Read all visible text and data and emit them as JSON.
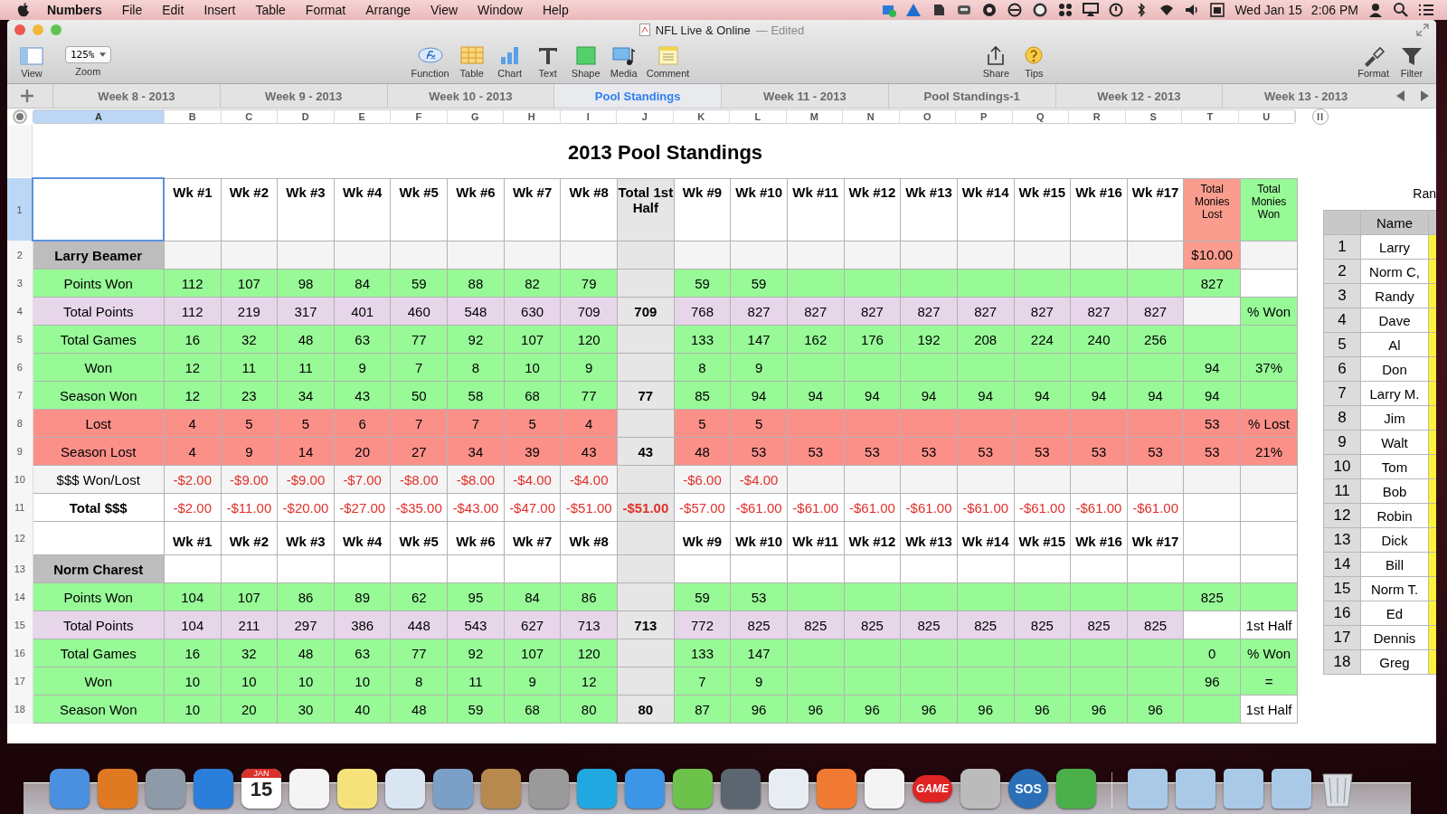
{
  "menubar": {
    "app": "Numbers",
    "menus": [
      "File",
      "Edit",
      "Insert",
      "Table",
      "Format",
      "Arrange",
      "View",
      "Window",
      "Help"
    ],
    "date": "Wed Jan 15",
    "time": "2:06 PM"
  },
  "window": {
    "title": "NFL Live & Online",
    "status": "— Edited"
  },
  "toolbar": {
    "view": "View",
    "zoom_value": "125%",
    "zoom_label": "Zoom",
    "center": [
      "Function",
      "Table",
      "Chart",
      "Text",
      "Shape",
      "Media",
      "Comment"
    ],
    "share": [
      "Share",
      "Tips"
    ],
    "right": [
      "Format",
      "Filter"
    ]
  },
  "sheet_tabs": [
    {
      "label": "Week 8 - 2013",
      "selected": false
    },
    {
      "label": "Week 9 - 2013",
      "selected": false
    },
    {
      "label": "Week 10 - 2013",
      "selected": false
    },
    {
      "label": "Pool Standings",
      "selected": true
    },
    {
      "label": "Week 11 - 2013",
      "selected": false
    },
    {
      "label": "Pool Standings-1",
      "selected": false
    },
    {
      "label": "Week 12 - 2013",
      "selected": false
    },
    {
      "label": "Week 13 - 2013",
      "selected": false
    }
  ],
  "columns": [
    {
      "letter": "A",
      "selected": true
    },
    {
      "letter": "B",
      "selected": false
    },
    {
      "letter": "C",
      "selected": false
    },
    {
      "letter": "D",
      "selected": false
    },
    {
      "letter": "E",
      "selected": false
    },
    {
      "letter": "F",
      "selected": false
    },
    {
      "letter": "G",
      "selected": false
    },
    {
      "letter": "H",
      "selected": false
    },
    {
      "letter": "I",
      "selected": false
    },
    {
      "letter": "J",
      "selected": false
    },
    {
      "letter": "K",
      "selected": false
    },
    {
      "letter": "L",
      "selected": false
    },
    {
      "letter": "M",
      "selected": false
    },
    {
      "letter": "N",
      "selected": false
    },
    {
      "letter": "O",
      "selected": false
    },
    {
      "letter": "P",
      "selected": false
    },
    {
      "letter": "Q",
      "selected": false
    },
    {
      "letter": "R",
      "selected": false
    },
    {
      "letter": "S",
      "selected": false
    },
    {
      "letter": "T",
      "selected": false
    },
    {
      "letter": "U",
      "selected": false
    }
  ],
  "sheet": {
    "title": "2013 Pool Standings",
    "rows": [
      {
        "num": "1",
        "selected": true,
        "kind": "header",
        "color": "#ffffff",
        "cells": [
          "Wk #1",
          "Wk #2",
          "Wk #3",
          "Wk #4",
          "Wk #5",
          "Wk #6",
          "Wk #7",
          "Wk #8",
          "Total 1st Half",
          "Wk #9",
          "Wk #10",
          "Wk #11",
          "Wk #12",
          "Wk #13",
          "Wk #14",
          "Wk #15",
          "Wk #16",
          "Wk #17"
        ],
        "lost": {
          "text": "Total Monies Lost",
          "color": "#fa9d8f"
        },
        "won": {
          "text": "Total Monies Won",
          "color": "#97fa97"
        }
      },
      {
        "num": "2",
        "selected": false,
        "kind": "name",
        "color": "#f4f4f4",
        "label": "Larry Beamer",
        "cells": [
          null,
          null,
          null,
          null,
          null,
          null,
          null,
          null,
          null,
          null,
          null,
          null,
          null,
          null,
          null,
          null,
          null,
          null
        ],
        "lost": {
          "text": "$10.00",
          "color": "#fa9d8f"
        },
        "won": {
          "color": "#f4f4f4"
        }
      },
      {
        "num": "3",
        "selected": false,
        "kind": "stat",
        "color": "#97fa97",
        "label": "Points Won",
        "cells": [
          "112",
          "107",
          "98",
          "84",
          "59",
          "88",
          "82",
          "79",
          null,
          "59",
          "59",
          null,
          null,
          null,
          null,
          null,
          null,
          null
        ],
        "lost": {
          "text": "827",
          "color": "#97fa97"
        },
        "won": {
          "color": "#ffffff"
        }
      },
      {
        "num": "4",
        "selected": false,
        "kind": "stat",
        "color": "#e7d6ea",
        "label": "Total Points",
        "cells": [
          "112",
          "219",
          "317",
          "401",
          "460",
          "548",
          "630",
          "709",
          "709",
          "768",
          "827",
          "827",
          "827",
          "827",
          "827",
          "827",
          "827",
          "827"
        ],
        "lost": {
          "color": "#f4f4f4"
        },
        "won": {
          "text": "% Won",
          "color": "#97fa97"
        }
      },
      {
        "num": "5",
        "selected": false,
        "kind": "stat",
        "color": "#97fa97",
        "label": "Total Games",
        "cells": [
          "16",
          "32",
          "48",
          "63",
          "77",
          "92",
          "107",
          "120",
          null,
          "133",
          "147",
          "162",
          "176",
          "192",
          "208",
          "224",
          "240",
          "256"
        ],
        "lost": {
          "color": "#97fa97"
        },
        "won": {
          "color": "#97fa97"
        }
      },
      {
        "num": "6",
        "selected": false,
        "kind": "stat",
        "color": "#97fa97",
        "label": "Won",
        "cells": [
          "12",
          "11",
          "11",
          "9",
          "7",
          "8",
          "10",
          "9",
          null,
          "8",
          "9",
          null,
          null,
          null,
          null,
          null,
          null,
          null
        ],
        "lost": {
          "text": "94",
          "color": "#97fa97"
        },
        "won": {
          "text": "37%",
          "color": "#97fa97"
        }
      },
      {
        "num": "7",
        "selected": false,
        "kind": "stat",
        "color": "#97fa97",
        "label": "Season Won",
        "cells": [
          "12",
          "23",
          "34",
          "43",
          "50",
          "58",
          "68",
          "77",
          "77",
          "85",
          "94",
          "94",
          "94",
          "94",
          "94",
          "94",
          "94",
          "94"
        ],
        "lost": {
          "text": "94",
          "color": "#97fa97"
        },
        "won": {
          "color": "#97fa97"
        }
      },
      {
        "num": "8",
        "selected": false,
        "kind": "stat",
        "color": "#fb9089",
        "label": "Lost",
        "cells": [
          "4",
          "5",
          "5",
          "6",
          "7",
          "7",
          "5",
          "4",
          null,
          "5",
          "5",
          null,
          null,
          null,
          null,
          null,
          null,
          null
        ],
        "lost": {
          "text": "53",
          "color": "#fb9089"
        },
        "won": {
          "text": "% Lost",
          "color": "#fb9089"
        }
      },
      {
        "num": "9",
        "selected": false,
        "kind": "stat",
        "color": "#fb9089",
        "label": "Season Lost",
        "cells": [
          "4",
          "9",
          "14",
          "20",
          "27",
          "34",
          "39",
          "43",
          "43",
          "48",
          "53",
          "53",
          "53",
          "53",
          "53",
          "53",
          "53",
          "53"
        ],
        "lost": {
          "text": "53",
          "color": "#fb9089"
        },
        "won": {
          "text": "21%",
          "color": "#fb9089"
        }
      },
      {
        "num": "10",
        "selected": false,
        "kind": "money",
        "color": "#f4f4f4",
        "label": "$$$ Won/Lost",
        "cells": [
          "-$2.00",
          "-$9.00",
          "-$9.00",
          "-$7.00",
          "-$8.00",
          "-$8.00",
          "-$4.00",
          "-$4.00",
          null,
          "-$6.00",
          "-$4.00",
          null,
          null,
          null,
          null,
          null,
          null,
          null
        ],
        "lost": {
          "color": "#f4f4f4"
        },
        "won": {
          "color": "#f4f4f4"
        }
      },
      {
        "num": "11",
        "selected": false,
        "kind": "total",
        "color": "#ffffff",
        "label": "Total $$$",
        "cells": [
          "-$2.00",
          "-$11.00",
          "-$20.00",
          "-$27.00",
          "-$35.00",
          "-$43.00",
          "-$47.00",
          "-$51.00",
          "-$51.00",
          "-$57.00",
          "-$61.00",
          "-$61.00",
          "-$61.00",
          "-$61.00",
          "-$61.00",
          "-$61.00",
          "-$61.00",
          "-$61.00"
        ],
        "lost": {
          "color": "#ffffff"
        },
        "won": {
          "color": "#ffffff"
        }
      },
      {
        "num": "12",
        "selected": false,
        "kind": "header",
        "color": "#ffffff",
        "cells": [
          "Wk #1",
          "Wk #2",
          "Wk #3",
          "Wk #4",
          "Wk #5",
          "Wk #6",
          "Wk #7",
          "Wk #8",
          null,
          "Wk #9",
          "Wk #10",
          "Wk #11",
          "Wk #12",
          "Wk #13",
          "Wk #14",
          "Wk #15",
          "Wk #16",
          "Wk #17"
        ],
        "lost": {
          "color": "#ffffff"
        },
        "won": {
          "color": "#ffffff"
        }
      },
      {
        "num": "13",
        "selected": false,
        "kind": "name",
        "color": "#ffffff",
        "label": "Norm Charest",
        "cells": [
          null,
          null,
          null,
          null,
          null,
          null,
          null,
          null,
          null,
          null,
          null,
          null,
          null,
          null,
          null,
          null,
          null,
          null
        ],
        "lost": {
          "color": "#ffffff"
        },
        "won": {
          "color": "#ffffff"
        }
      },
      {
        "num": "14",
        "selected": false,
        "kind": "stat",
        "color": "#97fa97",
        "label": "Points Won",
        "cells": [
          "104",
          "107",
          "86",
          "89",
          "62",
          "95",
          "84",
          "86",
          null,
          "59",
          "53",
          null,
          null,
          null,
          null,
          null,
          null,
          null
        ],
        "lost": {
          "text": "825",
          "color": "#97fa97"
        },
        "won": {
          "color": "#97fa97"
        }
      },
      {
        "num": "15",
        "selected": false,
        "kind": "stat",
        "color": "#e7d6ea",
        "label": "Total Points",
        "cells": [
          "104",
          "211",
          "297",
          "386",
          "448",
          "543",
          "627",
          "713",
          "713",
          "772",
          "825",
          "825",
          "825",
          "825",
          "825",
          "825",
          "825",
          "825"
        ],
        "lost": {
          "color": "#ffffff"
        },
        "won": {
          "text": "1st Half",
          "color": "#ffffff"
        }
      },
      {
        "num": "16",
        "selected": false,
        "kind": "stat",
        "color": "#97fa97",
        "label": "Total Games",
        "cells": [
          "16",
          "32",
          "48",
          "63",
          "77",
          "92",
          "107",
          "120",
          null,
          "133",
          "147",
          null,
          null,
          null,
          null,
          null,
          null,
          null
        ],
        "lost": {
          "text": "0",
          "color": "#97fa97"
        },
        "won": {
          "text": "% Won",
          "color": "#97fa97"
        }
      },
      {
        "num": "17",
        "selected": false,
        "kind": "stat",
        "color": "#97fa97",
        "label": "Won",
        "cells": [
          "10",
          "10",
          "10",
          "10",
          "8",
          "11",
          "9",
          "12",
          null,
          "7",
          "9",
          null,
          null,
          null,
          null,
          null,
          null,
          null
        ],
        "lost": {
          "text": "96",
          "color": "#97fa97"
        },
        "won": {
          "text": "=",
          "color": "#97fa97"
        }
      },
      {
        "num": "18",
        "selected": false,
        "kind": "stat",
        "color": "#97fa97",
        "label": "Season Won",
        "cells": [
          "10",
          "20",
          "30",
          "40",
          "48",
          "59",
          "68",
          "80",
          "80",
          "87",
          "96",
          "96",
          "96",
          "96",
          "96",
          "96",
          "96",
          "96"
        ],
        "lost": {
          "color": "#97fa97"
        },
        "won": {
          "text": "1st Half",
          "color": "#ffffff"
        }
      }
    ]
  },
  "rank_table": {
    "caption": "Ran",
    "header": "Name",
    "rows": [
      {
        "num": "1",
        "name": "Larry"
      },
      {
        "num": "2",
        "name": "Norm C,"
      },
      {
        "num": "3",
        "name": "Randy"
      },
      {
        "num": "4",
        "name": "Dave"
      },
      {
        "num": "5",
        "name": "Al"
      },
      {
        "num": "6",
        "name": "Don"
      },
      {
        "num": "7",
        "name": "Larry M."
      },
      {
        "num": "8",
        "name": "Jim"
      },
      {
        "num": "9",
        "name": "Walt"
      },
      {
        "num": "10",
        "name": "Tom"
      },
      {
        "num": "11",
        "name": "Bob"
      },
      {
        "num": "12",
        "name": "Robin"
      },
      {
        "num": "13",
        "name": "Dick"
      },
      {
        "num": "14",
        "name": "Bill"
      },
      {
        "num": "15",
        "name": "Norm T."
      },
      {
        "num": "16",
        "name": "Ed"
      },
      {
        "num": "17",
        "name": "Dennis"
      },
      {
        "num": "18",
        "name": "Greg"
      }
    ]
  },
  "dock": {
    "calendar_month": "JAN",
    "calendar_day": "15",
    "game_badge": "GAME",
    "sos_badge": "SOS"
  }
}
